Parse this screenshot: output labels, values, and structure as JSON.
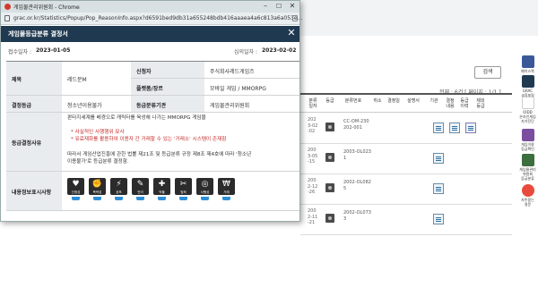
{
  "browser": {
    "window_title": "게임물관리위원회 - Chrome",
    "url": "grac.or.kr/Statistics/Popup/Pop_ReasonInfo.aspx?d6591bed9db31a655248bdb416aaaea4a6c813a6a053e..."
  },
  "popup": {
    "title": "게임물등급분류 결정서",
    "receipt_label": "접수일자 :",
    "receipt_date": "2023-01-05",
    "review_label": "심의일자 :",
    "review_date": "2023-02-02",
    "fields": {
      "title_label": "제목",
      "title_value": "레드문M",
      "applicant_label": "신청자",
      "applicant_value": "주식회사레드게임즈",
      "platform_label": "플랫폼/장르",
      "platform_value": "모바일 게임 / MMORPG",
      "rating_label": "결정등급",
      "rating_value": "청소년이용불가",
      "agency_label": "등급분류기관",
      "agency_value": "게임물관리위원회",
      "reason_label": "등급결정사유",
      "reason_lines": [
        "판타지세계를 배경으로 캐릭터를 육성해 나가는 MMORPG 게임물",
        "* 사실적인 사행행위 묘사",
        "* 유료재화를 활용하여 이용자 간 거래할 수 있는 ‘거래소’ 시스템이 존재함",
        "따라서 게임산업진흥에 관한 법률 제21조 및 등급분류 규정 제8조 제4호에 따라 '청소년",
        "이용불가'로 등급분류 결정함."
      ],
      "content_label": "내용정보표시사항"
    },
    "content_icons": [
      {
        "name": "선정성",
        "glyph": "♥"
      },
      {
        "name": "폭력성",
        "glyph": "✊"
      },
      {
        "name": "공포",
        "glyph": "⚡"
      },
      {
        "name": "언어",
        "glyph": "✎"
      },
      {
        "name": "약물",
        "glyph": "✚"
      },
      {
        "name": "범죄",
        "glyph": "✂"
      },
      {
        "name": "사행성",
        "glyph": "◎"
      },
      {
        "name": "거래",
        "glyph": "₩"
      }
    ]
  },
  "background": {
    "search_button": "검색",
    "result_count": "전체 : 6건 [ 페이지 : 1/1 ]",
    "headers": [
      "분류\n일자",
      "등급",
      "분류번호",
      "취소",
      "결정일",
      "설명서",
      "기관",
      "결정\n내용",
      "등급\n이력",
      "제외\n등급"
    ],
    "rows": [
      {
        "date": "2023-02-02",
        "cert": "CC-OM-230\n202-001"
      },
      {
        "date": "2003-05-15",
        "cert": "2003-OL023\n1"
      },
      {
        "date": "2002-12-26",
        "cert": "2002-OL082\n5"
      },
      {
        "date": "2002-11-21",
        "cert": "2002-OL073\n3"
      }
    ],
    "rail": [
      {
        "label": "페이스북",
        "color": "#3b5998"
      },
      {
        "label": "GRAC\n교육포털",
        "color": "#1f3950"
      },
      {
        "label": "OIDD\n온라인게임\n자가진단",
        "color": "#ffffff"
      },
      {
        "label": "게임이용\n등급확인",
        "color": "#7b4fa0"
      },
      {
        "label": "게임물관리\n위원회\n등급분류",
        "color": "#3d6e3d"
      },
      {
        "label": "자주묻는\n질문",
        "color": "#e84a3b"
      }
    ]
  }
}
